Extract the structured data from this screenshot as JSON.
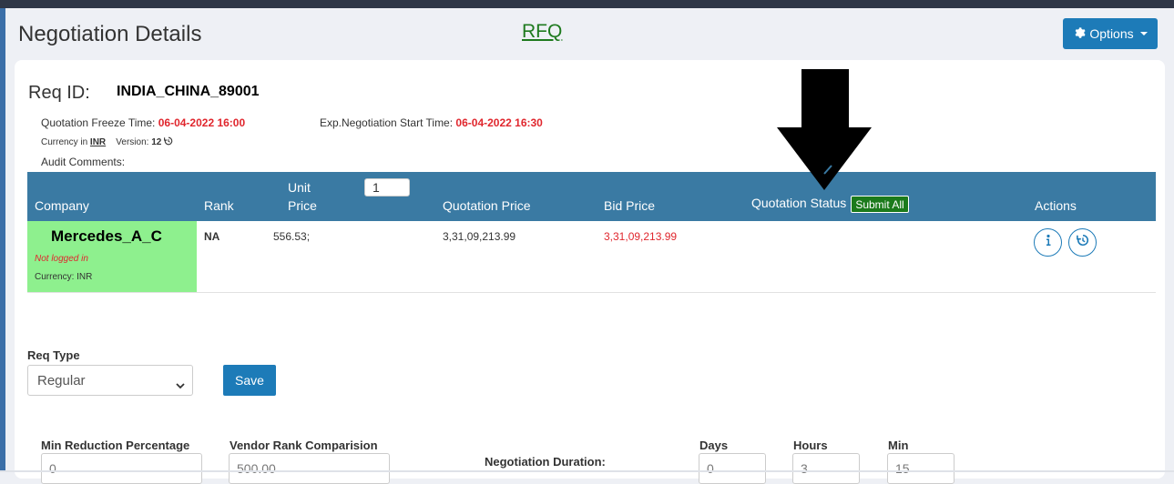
{
  "header": {
    "title": "Negotiation Details",
    "rfq_link": "RFQ",
    "options_label": "Options"
  },
  "requirement": {
    "req_id_label": "Req ID:",
    "req_id": "INDIA_CHINA_89001",
    "freeze_label": "Quotation Freeze Time:",
    "freeze_time": "06-04-2022 16:00",
    "neg_start_label": "Exp.Negotiation Start Time:",
    "neg_start_time": "06-04-2022 16:30",
    "currency_label": "Currency in",
    "currency": "INR",
    "version_label": "Version:",
    "version": "12",
    "audit_label": "Audit Comments:"
  },
  "grid": {
    "headers": {
      "company": "Company",
      "rank": "Rank",
      "unit_price_1": "Unit",
      "unit_price_2": "Price",
      "quotation_price": "Quotation Price",
      "bid_price": "Bid Price",
      "quotation_status": "Quotation Status",
      "actions": "Actions"
    },
    "quantity_value": "1",
    "submit_all_label": "Submit All",
    "rows": [
      {
        "company": "Mercedes_A_C",
        "login_status": "Not logged in",
        "currency": "Currency: INR",
        "rank": "NA",
        "unit_price": "556.53;",
        "quotation_price": "3,31,09,213.99",
        "bid_price": "3,31,09,213.99"
      }
    ]
  },
  "form": {
    "req_type_label": "Req Type",
    "req_type_value": "Regular",
    "save_label": "Save",
    "min_reduction_label": "Min Reduction Percentage",
    "min_reduction_value": "0",
    "vendor_rank_label": "Vendor Rank Comparision",
    "vendor_rank_value": "500.00",
    "negotiation_duration_label": "Negotiation Duration:",
    "days_label": "Days",
    "days_value": "0",
    "hours_label": "Hours",
    "hours_value": "3",
    "min_label": "Min",
    "min_value": "15"
  },
  "colors": {
    "primary": "#1d7bb8",
    "grid_header": "#3a7aa3",
    "company_highlight": "#8ef08e",
    "alert_red": "#e0262d",
    "success_green": "#1b7a1b"
  },
  "icons": [
    "gear-icon",
    "caret-down-icon",
    "history-icon",
    "info-icon",
    "chevron-down-icon",
    "down-arrow-annotation"
  ]
}
